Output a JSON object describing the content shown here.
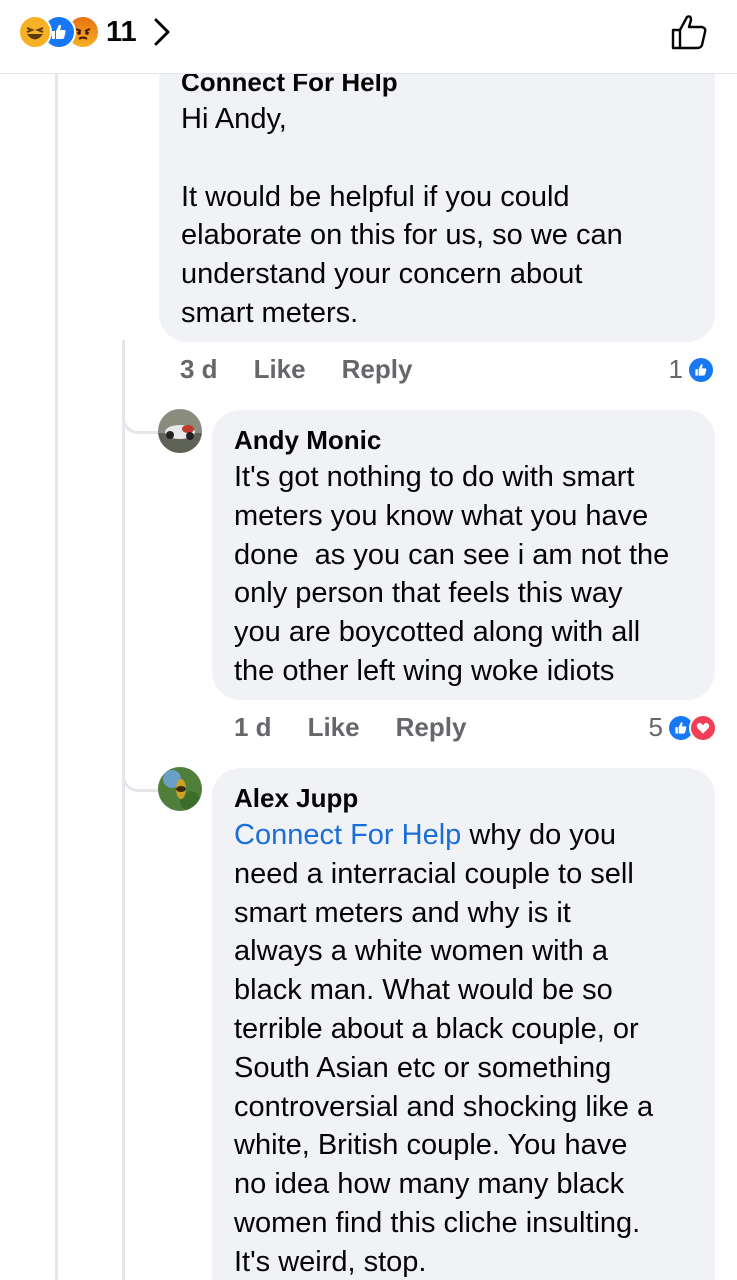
{
  "reactions_bar": {
    "total_count": "11",
    "types": [
      "haha",
      "like",
      "angry"
    ],
    "colors": {
      "like": "#1877f2",
      "haha": "#f7b125",
      "angry": "#e9710f",
      "love": "#f33e58"
    }
  },
  "comments": [
    {
      "author": "Connect For Help",
      "text": "Hi Andy,\n\nIt would be helpful if you could\nelaborate on this for us, so we can\nunderstand your concern about\nsmart meters.",
      "time": "3 d",
      "like_label": "Like",
      "reply_label": "Reply",
      "reaction_count": "1",
      "reaction_types": [
        "like"
      ]
    },
    {
      "author": "Andy Monic",
      "text": "It's got nothing to do with smart\nmeters you know what you have\ndone  as you can see i am not the\nonly person that feels this way\nyou are boycotted along with all\nthe other left wing woke idiots",
      "time": "1 d",
      "like_label": "Like",
      "reply_label": "Reply",
      "reaction_count": "5",
      "reaction_types": [
        "like",
        "love"
      ]
    },
    {
      "author": "Alex Jupp",
      "mention": "Connect For Help",
      "text_after_mention": " why do you",
      "text": "need a interracial couple to sell\nsmart meters and why is it\nalways a white women with a\nblack man. What would be so\nterrible about a black couple, or\nSouth Asian etc or something\ncontroversial and shocking like a\nwhite, British couple. You have\nno idea how many many black\nwomen find this cliche insulting.\nIt's weird, stop."
    }
  ]
}
